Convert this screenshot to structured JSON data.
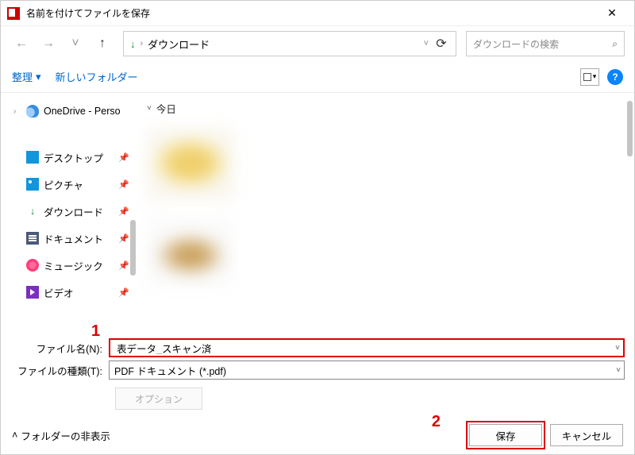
{
  "titlebar": {
    "title": "名前を付けてファイルを保存"
  },
  "nav": {
    "back": "←",
    "forward": "→",
    "recent": "˅",
    "up": "↑",
    "refresh": "⟳",
    "address_icon": "↓",
    "address_sep": "›",
    "address_folder": "ダウンロード",
    "addr_dd": "˅"
  },
  "search": {
    "placeholder": "ダウンロードの検索",
    "icon": "⌕"
  },
  "toolbar": {
    "organize": "整理",
    "org_dd": "▾",
    "new_folder": "新しいフォルダー",
    "view_dd": "▾",
    "help": "?"
  },
  "sidebar": {
    "items": [
      {
        "label": "OneDrive - Perso",
        "icon": "cloud",
        "expand": "›",
        "pin": ""
      },
      {
        "label": "デスクトップ",
        "icon": "desktop",
        "pin": "📌"
      },
      {
        "label": "ピクチャ",
        "icon": "pictures",
        "pin": "📌"
      },
      {
        "label": "ダウンロード",
        "icon": "download",
        "pin": "📌"
      },
      {
        "label": "ドキュメント",
        "icon": "document",
        "pin": "📌"
      },
      {
        "label": "ミュージック",
        "icon": "music",
        "pin": "📌"
      },
      {
        "label": "ビデオ",
        "icon": "video",
        "pin": "📌"
      }
    ]
  },
  "content": {
    "group_expand": "˅",
    "group": "今日"
  },
  "fields": {
    "filename_label": "ファイル名(N):",
    "filename_value": "表データ_スキャン済",
    "filetype_label": "ファイルの種類(T):",
    "filetype_value": "PDF ドキュメント (*.pdf)",
    "options": "オプション"
  },
  "footer": {
    "fold_icon": "˄",
    "hide_folders": "フォルダーの非表示",
    "save": "保存",
    "cancel": "キャンセル"
  },
  "annotations": {
    "one": "1",
    "two": "2"
  }
}
